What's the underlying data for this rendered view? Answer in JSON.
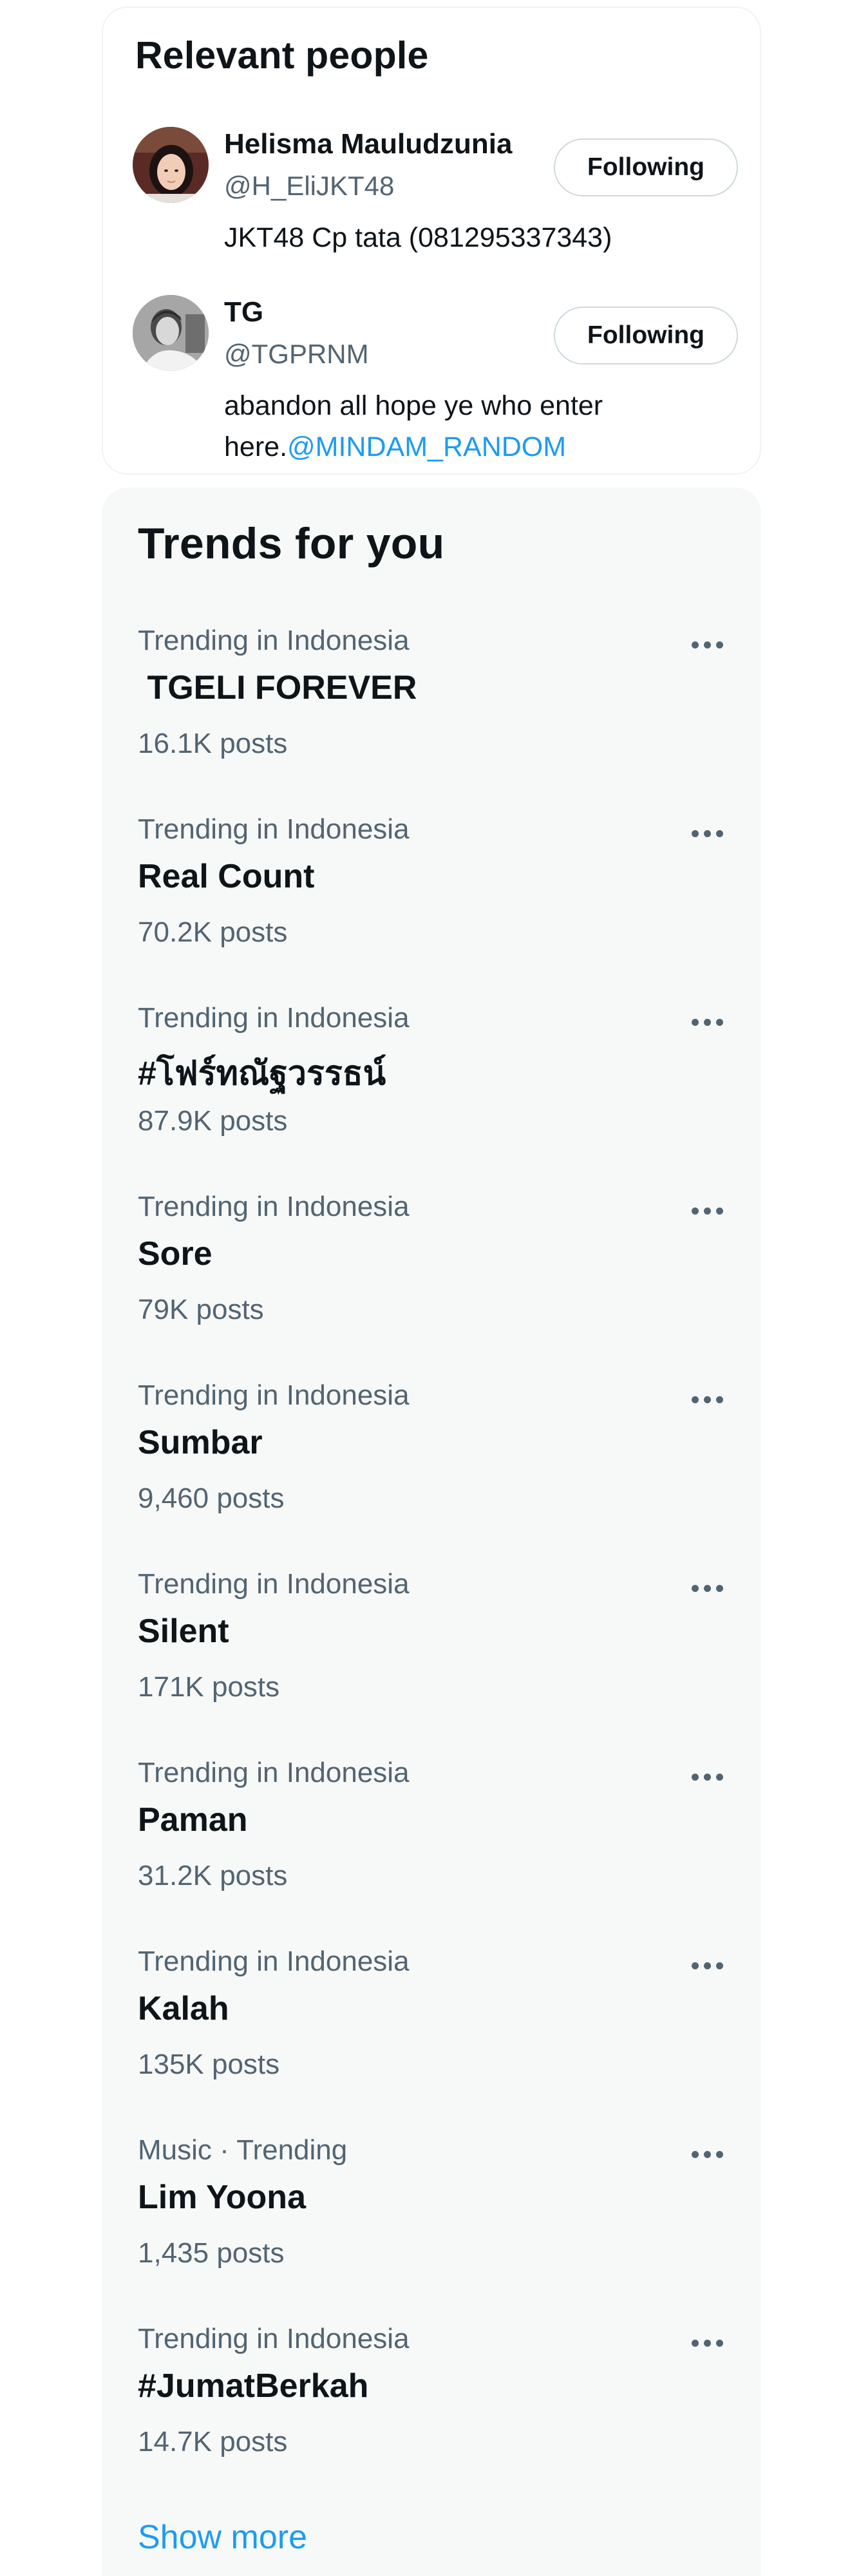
{
  "relevant_people": {
    "title": "Relevant people",
    "people": [
      {
        "name": "Helisma Mauludzunia",
        "handle": "@H_EliJKT48",
        "bio": "JKT48 Cp tata (081295337343)",
        "button_label": "Following",
        "avatar": "portrait-photo-avatar"
      },
      {
        "name": "TG",
        "handle": "@TGPRNM",
        "bio": "abandon all hope ye who enter here.",
        "bio_mention": "@MINDAM_RANDOM",
        "button_label": "Following",
        "avatar": "grayscale-portrait-avatar"
      }
    ]
  },
  "trends": {
    "title": "Trends for you",
    "items": [
      {
        "context": "Trending in Indonesia",
        "topic": " TGELI FOREVER",
        "count": "16.1K posts"
      },
      {
        "context": "Trending in Indonesia",
        "topic": "Real Count",
        "count": "70.2K posts"
      },
      {
        "context": "Trending in Indonesia",
        "topic": "#โฟร์ทณัฐวรรธน์",
        "count": "87.9K posts"
      },
      {
        "context": "Trending in Indonesia",
        "topic": "Sore",
        "count": "79K posts"
      },
      {
        "context": "Trending in Indonesia",
        "topic": "Sumbar",
        "count": "9,460 posts"
      },
      {
        "context": "Trending in Indonesia",
        "topic": "Silent",
        "count": "171K posts"
      },
      {
        "context": "Trending in Indonesia",
        "topic": "Paman",
        "count": "31.2K posts"
      },
      {
        "context": "Trending in Indonesia",
        "topic": "Kalah",
        "count": "135K posts"
      },
      {
        "context": "Music · Trending",
        "topic": "Lim Yoona",
        "count": "1,435 posts"
      },
      {
        "context": "Trending in Indonesia",
        "topic": "#JumatBerkah",
        "count": "14.7K posts"
      }
    ],
    "more_icon": "more-horizontal-icon",
    "show_more_label": "Show more"
  },
  "colors": {
    "primary_text": "#0f1419",
    "secondary_text": "#536471",
    "link": "#1d9bf0",
    "card_background": "#f7f9f9",
    "border": "#eff3f4"
  }
}
